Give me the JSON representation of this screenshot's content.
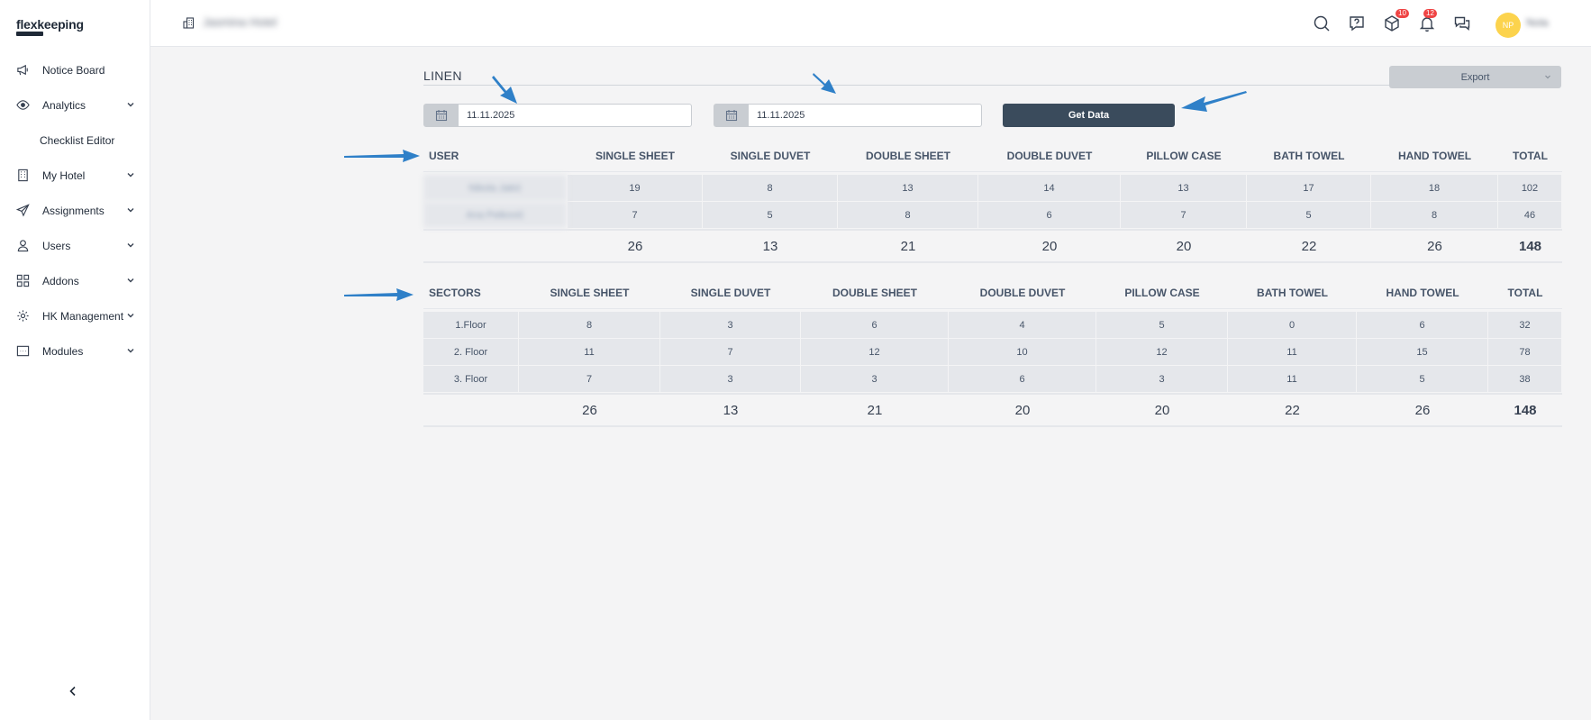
{
  "app": {
    "logo": "flexkeeping",
    "hotel_name": "Jasmina Hotel"
  },
  "sidebar": {
    "items": [
      {
        "label": "Notice Board",
        "icon": "megaphone-icon",
        "chevron": false
      },
      {
        "label": "Analytics",
        "icon": "eye-icon",
        "chevron": true
      },
      {
        "label": "Checklist Editor",
        "icon": "",
        "chevron": false
      },
      {
        "label": "My Hotel",
        "icon": "building-icon",
        "chevron": true
      },
      {
        "label": "Assignments",
        "icon": "send-icon",
        "chevron": true
      },
      {
        "label": "Users",
        "icon": "user-icon",
        "chevron": true
      },
      {
        "label": "Addons",
        "icon": "grid-icon",
        "chevron": true
      },
      {
        "label": "HK Management",
        "icon": "gear-icon",
        "chevron": true
      },
      {
        "label": "Modules",
        "icon": "modules-icon",
        "chevron": true
      }
    ]
  },
  "topbar": {
    "cube_badge": "10",
    "bell_badge": "12",
    "avatar_initials": "NP",
    "user_name": "Nola"
  },
  "page": {
    "title": "LINEN",
    "export_label": "Export",
    "date_from": "11.11.2025",
    "date_to": "11.11.2025",
    "get_data_label": "Get Data"
  },
  "user_table": {
    "headers": [
      "USER",
      "SINGLE SHEET",
      "SINGLE DUVET",
      "DOUBLE SHEET",
      "DOUBLE DUVET",
      "PILLOW CASE",
      "BATH TOWEL",
      "HAND TOWEL",
      "TOTAL"
    ],
    "rows": [
      [
        "Nikola Jakić",
        "19",
        "8",
        "13",
        "14",
        "13",
        "17",
        "18",
        "102"
      ],
      [
        "Ana Petković",
        "7",
        "5",
        "8",
        "6",
        "7",
        "5",
        "8",
        "46"
      ]
    ],
    "totals": [
      "",
      "26",
      "13",
      "21",
      "20",
      "20",
      "22",
      "26",
      "148"
    ]
  },
  "sector_table": {
    "headers": [
      "SECTORS",
      "SINGLE SHEET",
      "SINGLE DUVET",
      "DOUBLE SHEET",
      "DOUBLE DUVET",
      "PILLOW CASE",
      "BATH TOWEL",
      "HAND TOWEL",
      "TOTAL"
    ],
    "rows": [
      [
        "1.Floor",
        "8",
        "3",
        "6",
        "4",
        "5",
        "0",
        "6",
        "32"
      ],
      [
        "2. Floor",
        "11",
        "7",
        "12",
        "10",
        "12",
        "11",
        "15",
        "78"
      ],
      [
        "3. Floor",
        "7",
        "3",
        "3",
        "6",
        "3",
        "11",
        "5",
        "38"
      ]
    ],
    "totals": [
      "",
      "26",
      "13",
      "21",
      "20",
      "20",
      "22",
      "26",
      "148"
    ]
  },
  "colors": {
    "accent_dark": "#3a4b5c",
    "arrow": "#2f80c8",
    "badge": "#ef4444",
    "avatar": "#fcd34d"
  }
}
